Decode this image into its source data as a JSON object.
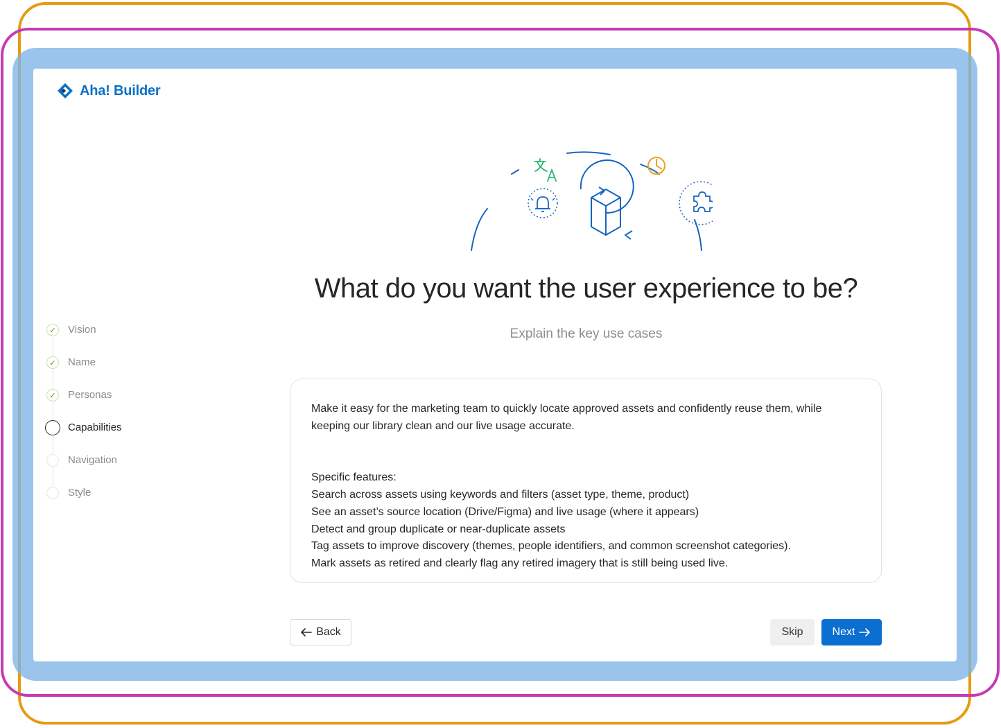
{
  "brand": {
    "name": "Aha! Builder",
    "color": "#0b6fc8"
  },
  "steps": [
    {
      "label": "Vision",
      "status": "done"
    },
    {
      "label": "Name",
      "status": "done"
    },
    {
      "label": "Personas",
      "status": "done"
    },
    {
      "label": "Capabilities",
      "status": "current"
    },
    {
      "label": "Navigation",
      "status": "todo"
    },
    {
      "label": "Style",
      "status": "todo"
    }
  ],
  "main": {
    "title": "What do you want the user experience to be?",
    "subtitle": "Explain the key use cases",
    "answer": "Make it easy for the marketing team to quickly locate approved assets and confidently reuse them, while keeping our library clean and our live usage accurate.\n\n\nSpecific features:\nSearch across assets using keywords and filters (asset type, theme, product)\nSee an asset’s source location (Drive/Figma) and live usage (where it appears)\nDetect and group duplicate or near-duplicate assets\nTag assets to improve discovery (themes, people identifiers, and common screenshot categories).\nMark assets as retired and clearly flag any retired imagery that is still being used live."
  },
  "footer": {
    "back_label": "Back",
    "skip_label": "Skip",
    "next_label": "Next"
  },
  "icons": {
    "illustration": [
      "translate-icon",
      "clock-icon",
      "bell-icon",
      "cube-icon",
      "puzzle-icon"
    ],
    "back": "arrow-left-icon",
    "next": "arrow-right-icon",
    "step_done": "checkmark-icon"
  },
  "colors": {
    "primary": "#0b6fcf",
    "step_done_border": "#c9e2a6",
    "step_done_check": "#4e8a1d",
    "illustration_blue": "#1565c0",
    "illustration_green": "#2bb673",
    "illustration_orange": "#f0a020"
  }
}
